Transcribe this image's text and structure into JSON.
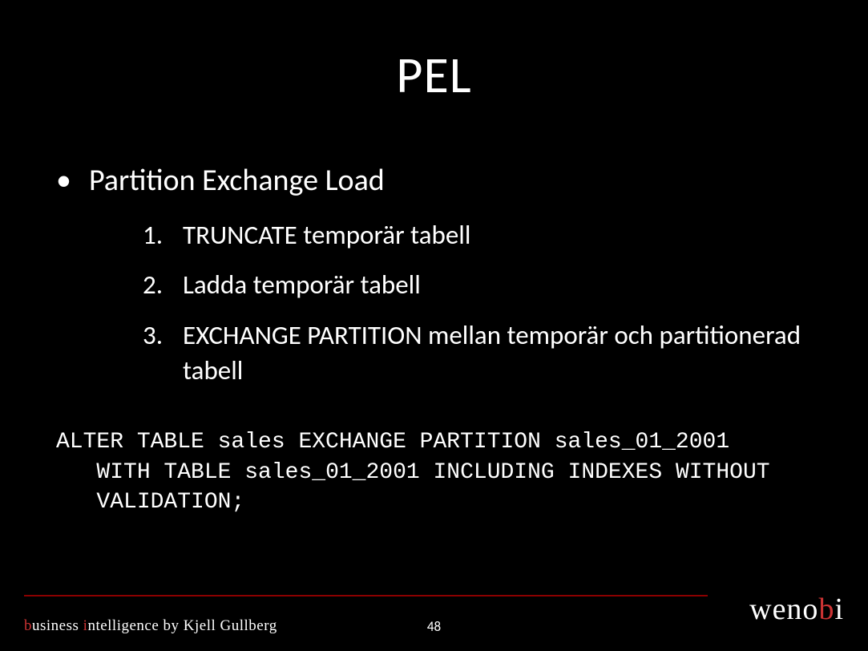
{
  "title": "PEL",
  "bullet": {
    "label": "Partition Exchange Load",
    "items": [
      "TRUNCATE  temporär tabell",
      "Ladda temporär tabell",
      "EXCHANGE PARTITION mellan temporär och partitionerad tabell"
    ]
  },
  "code": "ALTER TABLE sales EXCHANGE PARTITION sales_01_2001\n   WITH TABLE sales_01_2001 INCLUDING INDEXES WITHOUT\n   VALIDATION;",
  "footer": {
    "tagline_b": "b",
    "tagline_usiness": "usiness ",
    "tagline_i": "i",
    "tagline_rest": "ntelligence by Kjell Gullberg",
    "page_number": "48",
    "logo_weno": "weno",
    "logo_b": "b",
    "logo_i": "i"
  }
}
